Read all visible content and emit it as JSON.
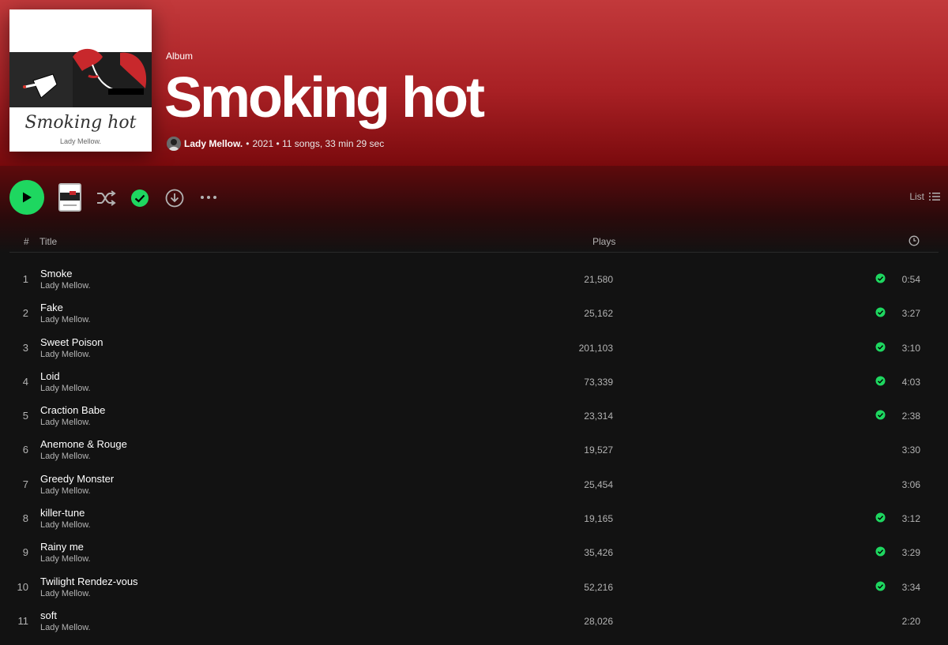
{
  "album": {
    "type_label": "Album",
    "title": "Smoking hot",
    "artist": "Lady Mellow.",
    "dot": "•",
    "details": "2021 • 11 songs, 33 min 29 sec",
    "cover_text": "Smoking hot",
    "cover_artist": "Lady Mellow."
  },
  "controls": {
    "view_label": "List"
  },
  "columns": {
    "number": "#",
    "title": "Title",
    "plays": "Plays"
  },
  "colors": {
    "accent": "#1ed760",
    "header_top": "#c2393b",
    "header_bottom": "#7a0a0d",
    "background": "#121212"
  },
  "tracks": [
    {
      "num": "1",
      "title": "Smoke",
      "artist": "Lady Mellow.",
      "plays": "21,580",
      "saved": true,
      "duration": "0:54"
    },
    {
      "num": "2",
      "title": "Fake",
      "artist": "Lady Mellow.",
      "plays": "25,162",
      "saved": true,
      "duration": "3:27"
    },
    {
      "num": "3",
      "title": "Sweet Poison",
      "artist": "Lady Mellow.",
      "plays": "201,103",
      "saved": true,
      "duration": "3:10"
    },
    {
      "num": "4",
      "title": "Loid",
      "artist": "Lady Mellow.",
      "plays": "73,339",
      "saved": true,
      "duration": "4:03"
    },
    {
      "num": "5",
      "title": "Craction Babe",
      "artist": "Lady Mellow.",
      "plays": "23,314",
      "saved": true,
      "duration": "2:38"
    },
    {
      "num": "6",
      "title": "Anemone & Rouge",
      "artist": "Lady Mellow.",
      "plays": "19,527",
      "saved": false,
      "duration": "3:30"
    },
    {
      "num": "7",
      "title": "Greedy Monster",
      "artist": "Lady Mellow.",
      "plays": "25,454",
      "saved": false,
      "duration": "3:06"
    },
    {
      "num": "8",
      "title": "killer-tune",
      "artist": "Lady Mellow.",
      "plays": "19,165",
      "saved": true,
      "duration": "3:12"
    },
    {
      "num": "9",
      "title": "Rainy me",
      "artist": "Lady Mellow.",
      "plays": "35,426",
      "saved": true,
      "duration": "3:29"
    },
    {
      "num": "10",
      "title": "Twilight Rendez-vous",
      "artist": "Lady Mellow.",
      "plays": "52,216",
      "saved": true,
      "duration": "3:34"
    },
    {
      "num": "11",
      "title": "soft",
      "artist": "Lady Mellow.",
      "plays": "28,026",
      "saved": false,
      "duration": "2:20"
    }
  ]
}
